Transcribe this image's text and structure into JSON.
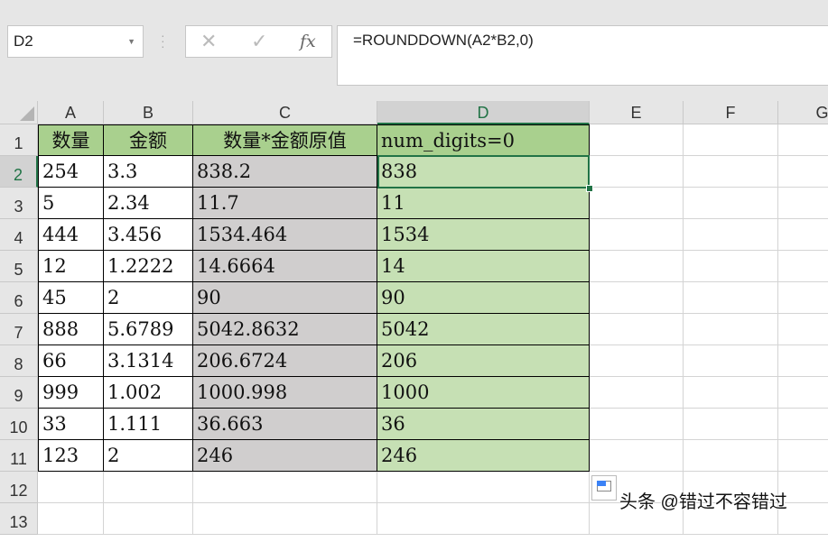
{
  "name_box": "D2",
  "formula": "=ROUNDDOWN(A2*B2,0)",
  "icons": {
    "cancel": "✕",
    "enter": "✓",
    "fx": "fx"
  },
  "columns": [
    "A",
    "B",
    "C",
    "D",
    "E",
    "F",
    "G"
  ],
  "rows": [
    "1",
    "2",
    "3",
    "4",
    "5",
    "6",
    "7",
    "8",
    "9",
    "10",
    "11",
    "12",
    "13"
  ],
  "header_row": [
    "数量",
    "金额",
    "数量*金额原值",
    "num_digits=0"
  ],
  "data": [
    [
      "254",
      "3.3",
      "838.2",
      "838"
    ],
    [
      "5",
      "2.34",
      "11.7",
      "11"
    ],
    [
      "444",
      "3.456",
      "1534.464",
      "1534"
    ],
    [
      "12",
      "1.2222",
      "14.6664",
      "14"
    ],
    [
      "45",
      "2",
      "90",
      "90"
    ],
    [
      "888",
      "5.6789",
      "5042.8632",
      "5042"
    ],
    [
      "66",
      "3.1314",
      "206.6724",
      "206"
    ],
    [
      "999",
      "1.002",
      "1000.998",
      "1000"
    ],
    [
      "33",
      "1.111",
      "36.663",
      "36"
    ],
    [
      "123",
      "2",
      "246",
      "246"
    ]
  ],
  "watermark": "头条 @错过不容错过",
  "colors": {
    "header_fill": "#a9d08e",
    "c_fill": "#d0cece",
    "d_fill": "#c6e0b4",
    "accent": "#217346"
  }
}
